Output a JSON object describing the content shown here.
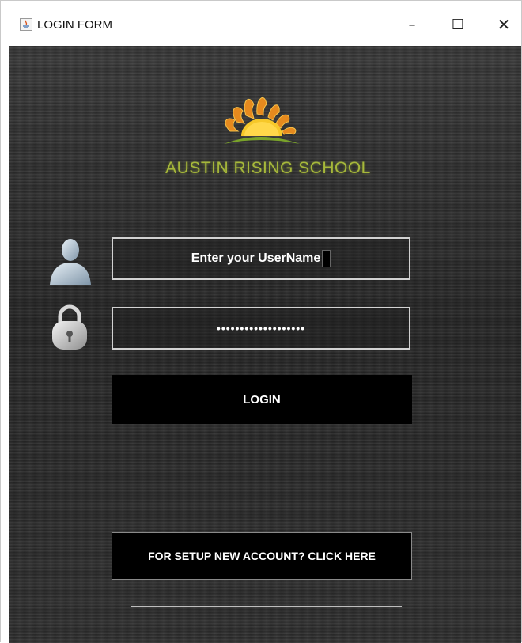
{
  "window": {
    "title": "LOGIN FORM",
    "controls": {
      "minimize": "–",
      "maximize": "☐",
      "close": "✕"
    }
  },
  "branding": {
    "school_name": "AUSTIN RISING SCHOOL",
    "logo_icon": "rising-sun-logo"
  },
  "form": {
    "username": {
      "value": "Enter your UserName",
      "icon": "user-icon"
    },
    "password": {
      "value": "•••••••••••••••••••",
      "icon": "lock-icon"
    },
    "login_label": "LOGIN",
    "setup_label": "FOR SETUP NEW ACCOUNT? CLICK HERE"
  },
  "colors": {
    "background": "#2b2b2b",
    "button": "#000000",
    "school_name": "#a6b83a",
    "field_border": "#d2d2d2"
  }
}
